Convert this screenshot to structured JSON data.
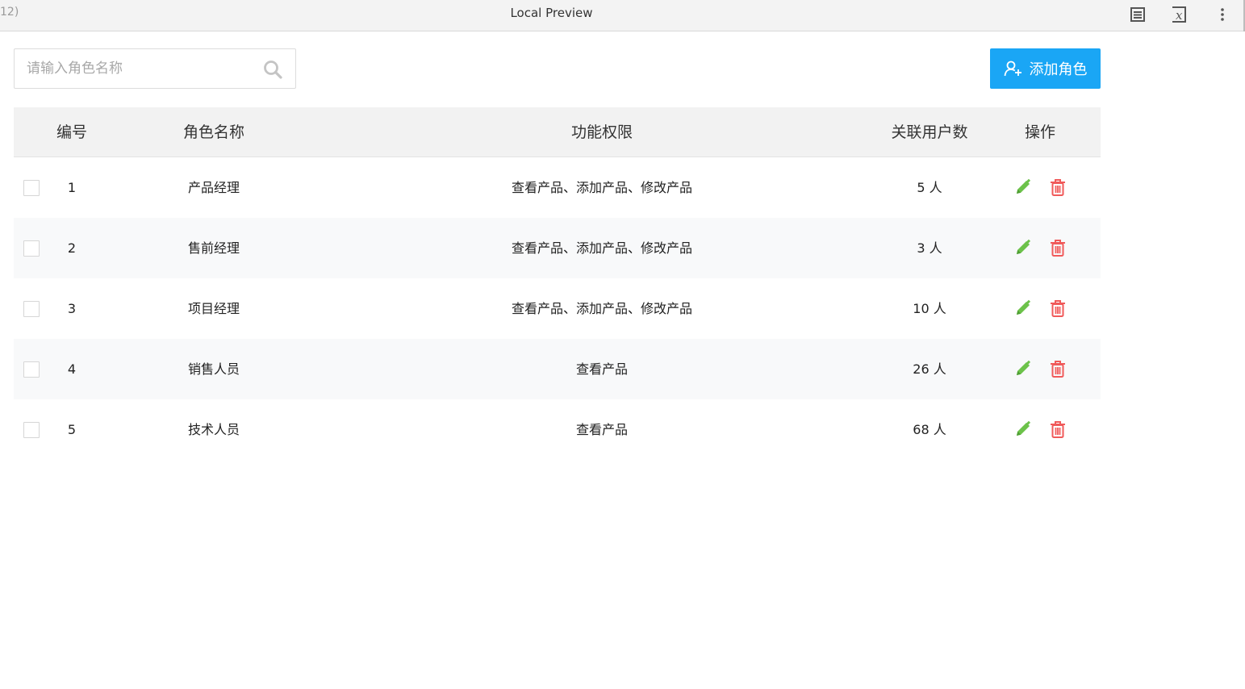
{
  "titlebar": {
    "tab_fragment": "12)",
    "title": "Local Preview",
    "icons": [
      "reader-icon",
      "formula-icon",
      "more-vertical-icon"
    ]
  },
  "search": {
    "value": "",
    "placeholder": "请输入角色名称",
    "icon": "search-icon"
  },
  "add_button": {
    "label": "添加角色",
    "icon": "add-user-icon",
    "color": "#1aa6f5"
  },
  "table": {
    "headers": {
      "no": "编号",
      "name": "角色名称",
      "permissions": "功能权限",
      "users": "关联用户数",
      "actions": "操作"
    },
    "rows": [
      {
        "no": "1",
        "name": "产品经理",
        "permissions": "查看产品、添加产品、修改产品",
        "users": "5 人"
      },
      {
        "no": "2",
        "name": "售前经理",
        "permissions": "查看产品、添加产品、修改产品",
        "users": "3 人"
      },
      {
        "no": "3",
        "name": "项目经理",
        "permissions": "查看产品、添加产品、修改产品",
        "users": "10 人"
      },
      {
        "no": "4",
        "name": "销售人员",
        "permissions": "查看产品",
        "users": "26 人"
      },
      {
        "no": "5",
        "name": "技术人员",
        "permissions": "查看产品",
        "users": "68 人"
      }
    ],
    "action_icons": {
      "edit": "pencil-icon",
      "delete": "trash-icon"
    },
    "colors": {
      "edit": "#6cc24a",
      "delete": "#f05a5a",
      "header_bg": "#f2f2f2",
      "stripe_bg": "#f8f9fa"
    }
  }
}
